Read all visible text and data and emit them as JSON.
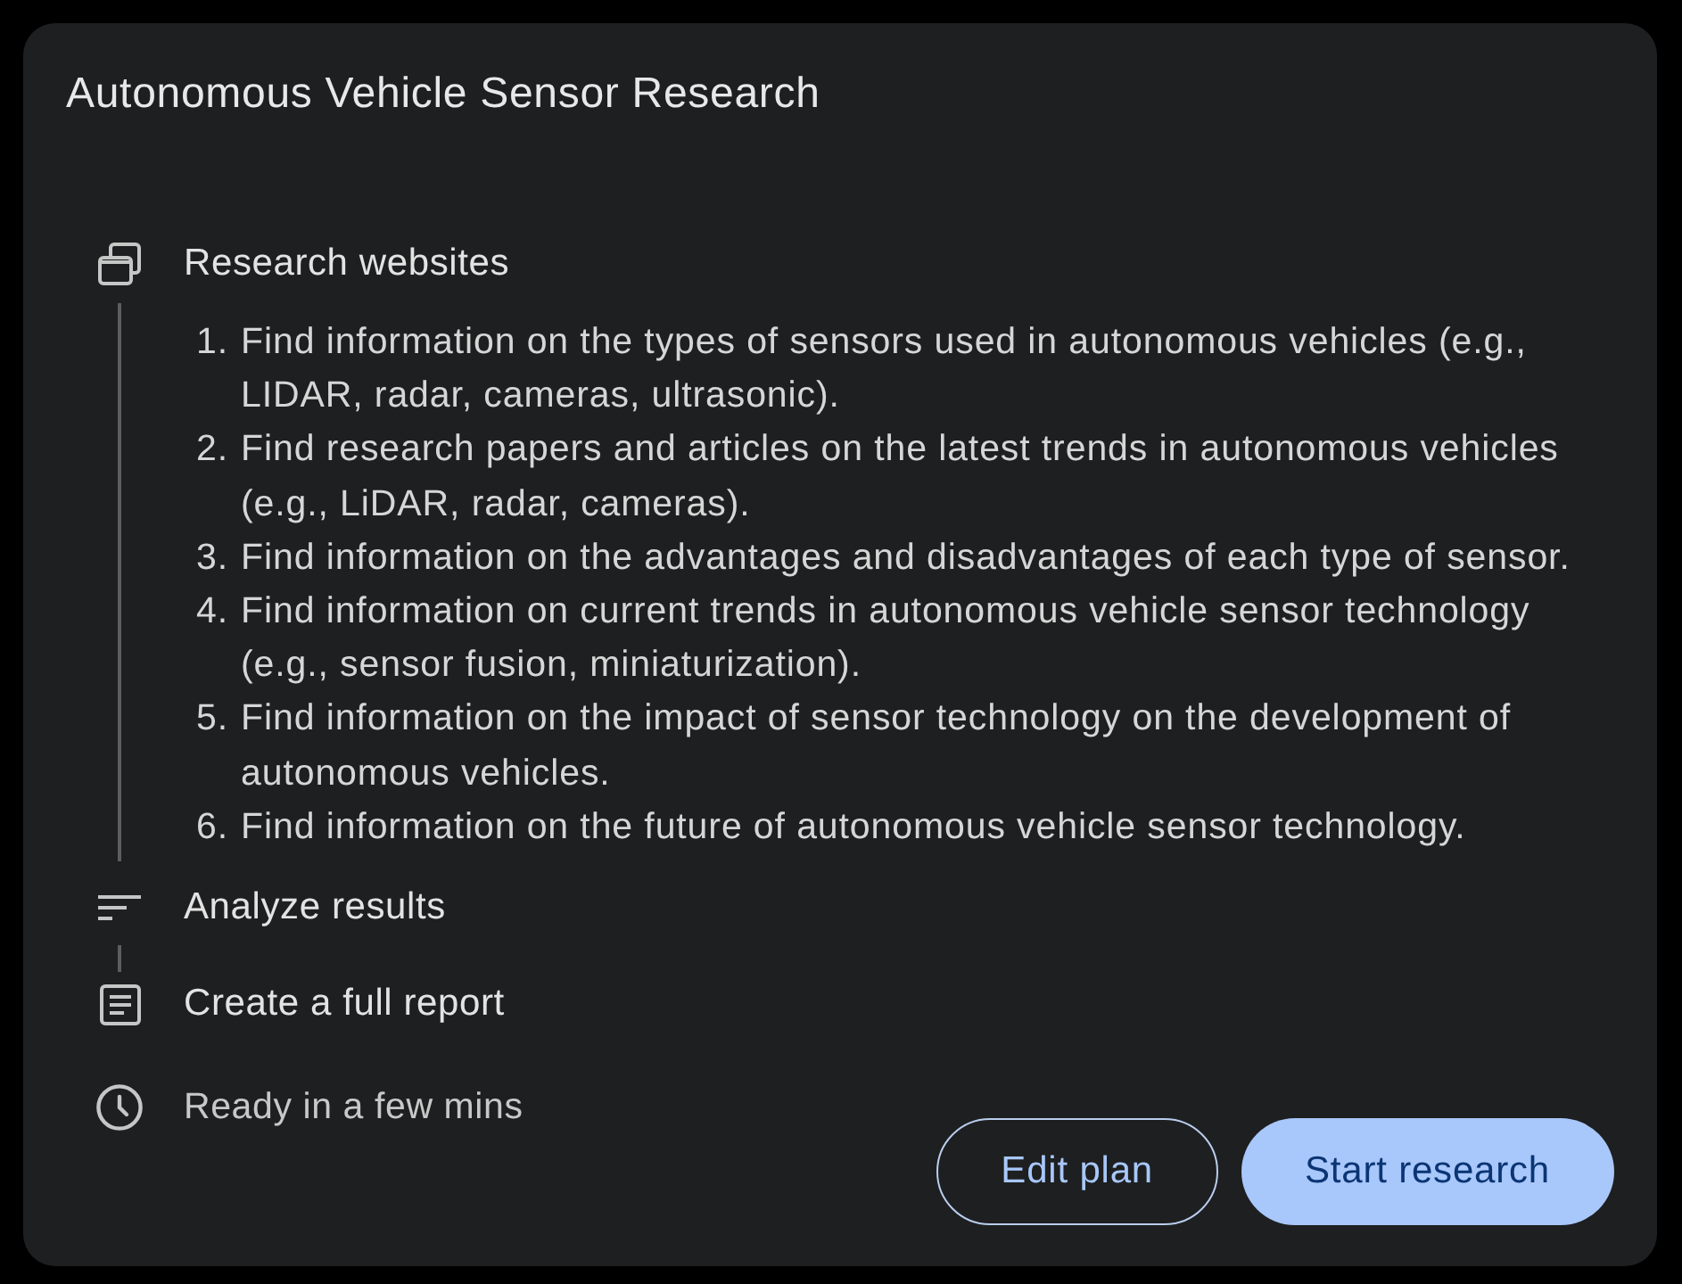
{
  "title": "Autonomous Vehicle Sensor Research",
  "steps": [
    {
      "kind": "browse",
      "label": "Research websites",
      "tasks": [
        {
          "number": "1.",
          "text": "Find information on the types of sensors used in autonomous vehicles (e.g., LIDAR, radar, cameras, ultrasonic)."
        },
        {
          "number": "2.",
          "text": "Find research papers and articles on the latest trends in autonomous vehicles (e.g., LiDAR, radar, cameras)."
        },
        {
          "number": "3.",
          "text": "Find information on the advantages and disadvantages of each type of sensor."
        },
        {
          "number": "4.",
          "text": "Find information on current trends in autonomous vehicle sensor technology (e.g., sensor fusion, miniaturization)."
        },
        {
          "number": "5.",
          "text": "Find information on the impact of sensor technology on the development of autonomous vehicles."
        },
        {
          "number": "6.",
          "text": "Find information on the future of autonomous vehicle sensor technology."
        }
      ]
    },
    {
      "kind": "analyze",
      "label": "Analyze results"
    },
    {
      "kind": "report",
      "label": "Create a full report"
    }
  ],
  "eta": {
    "label": "Ready in a few mins"
  },
  "actions": [
    {
      "kind": "outlined",
      "label": "Edit plan"
    },
    {
      "kind": "filled",
      "label": "Start research"
    }
  ]
}
